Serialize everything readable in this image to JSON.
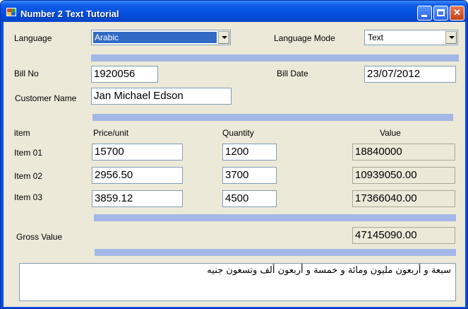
{
  "window": {
    "title": "Number 2 Text Tutorial"
  },
  "language": {
    "label": "Language",
    "value": "Arabic"
  },
  "language_mode": {
    "label": "Language Mode",
    "value": "Text"
  },
  "bill": {
    "no_label": "Bill No",
    "no_value": "1920056",
    "date_label": "Bill Date",
    "date_value": "23/07/2012",
    "customer_label": "Customer Name",
    "customer_value": "Jan Michael Edson"
  },
  "table": {
    "headers": {
      "item": "item",
      "price": "Price/unit",
      "quantity": "Quantity",
      "value": "Value"
    },
    "rows": [
      {
        "item": "Item 01",
        "price": "15700",
        "quantity": "1200",
        "value": "18840000"
      },
      {
        "item": "Item 02",
        "price": "2956.50",
        "quantity": "3700",
        "value": "10939050.00"
      },
      {
        "item": "Item 03",
        "price": "3859.12",
        "quantity": "4500",
        "value": "17366040.00"
      }
    ]
  },
  "gross": {
    "label": "Gross Value",
    "value": "47145090.00"
  },
  "output": {
    "text": "سبعة و أربعون مليون ومائة و خمسة و أربعون ألف وتسعون جنيه"
  },
  "colors": {
    "separator": "#a3b8e6",
    "selection": "#316ac5",
    "client": "#ece9d8"
  }
}
